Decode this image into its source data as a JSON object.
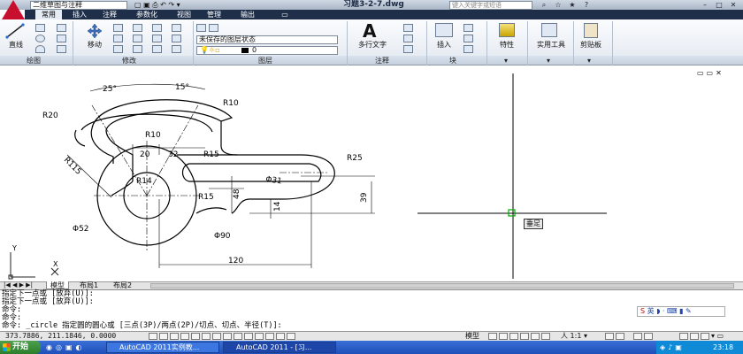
{
  "window": {
    "workspace": "二维草图与注释",
    "title": "习题3-2-7.dwg",
    "search_placeholder": "键入关键字或短语"
  },
  "tabs": [
    "常用",
    "插入",
    "注释",
    "参数化",
    "视图",
    "管理",
    "输出"
  ],
  "ribbon": {
    "draw": {
      "line_label": "直线",
      "panel": "绘图"
    },
    "modify": {
      "move_label": "移动",
      "panel": "修改"
    },
    "layers": {
      "state": "未保存的图层状态",
      "current_layer": "0",
      "panel": "图层"
    },
    "annotation": {
      "mtext_label": "多行文字",
      "panel": "注释"
    },
    "block": {
      "insert_label": "插入",
      "panel": "块"
    },
    "properties_label": "特性",
    "utilities_label": "实用工具",
    "clipboard_label": "剪贴板"
  },
  "drawing": {
    "dims": {
      "a25": "25°",
      "a15": "15°",
      "r20": "R20",
      "r10a": "R10",
      "r10b": "R10",
      "r115": "R115",
      "d20": "20",
      "d32": "32",
      "r15a": "R15",
      "r25": "R25",
      "r14": "R14",
      "r15b": "R15",
      "d48": "48",
      "d14": "14",
      "d39": "39",
      "d31": "Φ31",
      "d52": "Φ52",
      "d90": "Φ90",
      "d120": "120"
    },
    "ucs_y": "Y",
    "ucs_x": "X",
    "osnap_tooltip": "垂足"
  },
  "layout_tabs": [
    "模型",
    "布局1",
    "布局2"
  ],
  "command_lines": [
    "指定下一点或 [放弃(U)]:",
    "指定下一点或 [放弃(U)]:",
    "命令:",
    "命令:",
    "命令: _circle 指定圆的圆心或 [三点(3P)/两点(2P)/切点、切点、半径(T)]:"
  ],
  "status": {
    "coords": "373.7886, 211.1846, 0.0000",
    "model_label": "模型",
    "scale": "1:1",
    "ime": "英"
  },
  "taskbar": {
    "start_label": "开始",
    "tasks": [
      "AutoCAD 2011实例教...",
      "AutoCAD 2011 - [习..."
    ],
    "clock": "23:18"
  },
  "colors": {
    "accent": "#1f2f4a",
    "autocad_red": "#c8102e"
  }
}
